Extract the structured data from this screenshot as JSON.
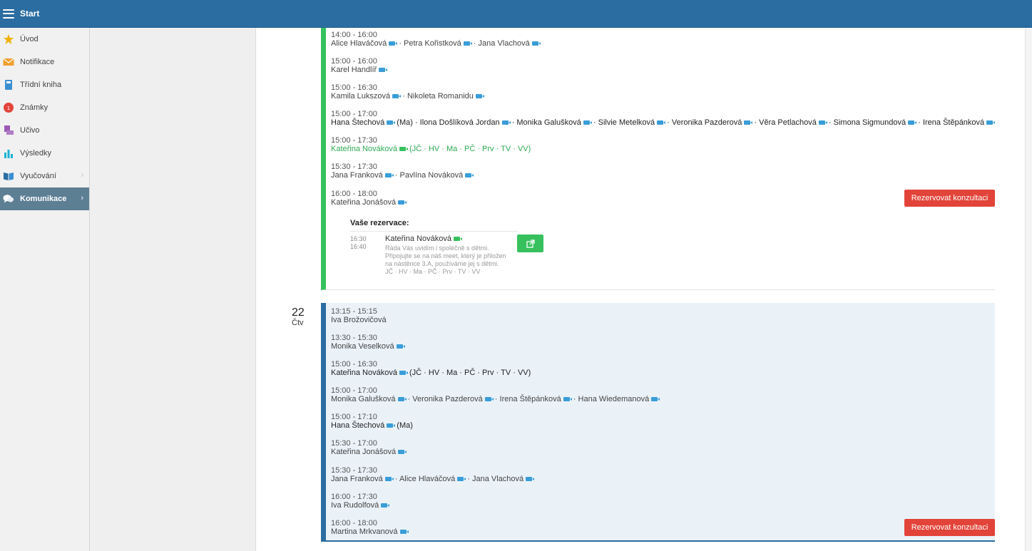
{
  "topbar": {
    "title": "Start"
  },
  "sidebar": {
    "items": [
      {
        "label": "Úvod",
        "icon": "star-icon",
        "color": "#f0b400"
      },
      {
        "label": "Notifikace",
        "icon": "envelope-icon",
        "color": "#f0a030"
      },
      {
        "label": "Třídní kniha",
        "icon": "book-icon",
        "color": "#3a8fd1"
      },
      {
        "label": "Známky",
        "icon": "grades-icon",
        "color": "#e2443a"
      },
      {
        "label": "Učivo",
        "icon": "curriculum-icon",
        "color": "#9b59b6"
      },
      {
        "label": "Výsledky",
        "icon": "bar-chart-icon",
        "color": "#1bb3d3"
      },
      {
        "label": "Vyučování",
        "icon": "open-book-icon",
        "color": "#2b6ca1"
      },
      {
        "label": "Komunikace",
        "icon": "chat-icon",
        "color": "#ffffff"
      }
    ]
  },
  "day1": {
    "slots": [
      {
        "time": "14:00 - 16:00",
        "people": [
          "Alice Hlaváčová",
          "Petra Kořistková",
          "Jana Vlachová"
        ],
        "suffix": ""
      },
      {
        "time": "15:00 - 16:00",
        "people": [
          "Karel Handlíř"
        ],
        "suffix": ""
      },
      {
        "time": "15:00 - 16:30",
        "people": [
          "Kamila Lukszová",
          "Nikoleta Romanidu"
        ],
        "suffix": ""
      },
      {
        "time": "15:00 - 17:00",
        "people": [
          "Hana Štechová",
          "Ilona Došlíková Jordan",
          "Monika Galušková",
          "Silvie Metelková",
          "Veronika Pazderová",
          "Věra Petlachová",
          "Simona Sigmundová",
          "Irena Štěpánková"
        ],
        "suffix": "(Ma)"
      },
      {
        "time": "15:00 - 17:30",
        "people": [
          "Kateřina Nováková"
        ],
        "suffix": "(JČ · HV · Ma · PČ · Prv · TV · VV)"
      },
      {
        "time": "15:30 - 17:30",
        "people": [
          "Jana Franková",
          "Pavlína Nováková"
        ],
        "suffix": ""
      },
      {
        "time": "16:00 - 18:00",
        "people": [
          "Kateřina Jonášová"
        ],
        "suffix": ""
      }
    ],
    "reserve_button": "Rezervovat konzultaci",
    "reservation": {
      "title": "Vaše rezervace:",
      "time_from": "16:30",
      "time_to": "16:40",
      "name": "Kateřina Nováková",
      "note_lines": [
        "Ráda Vás uvidím i společně s dětmi.",
        "Připojujte se na náš meet, který je přiložen",
        "na nástěnce 3.A, používáme jej s dětmi.",
        "JČ · HV · Ma · PČ · Prv · TV · VV"
      ]
    }
  },
  "day2": {
    "num": "22",
    "name": "Čtv",
    "slots": [
      {
        "time": "13:15 - 15:15",
        "people": [
          "Iva Brožovičová"
        ],
        "suffix": "",
        "nocam": true
      },
      {
        "time": "13:30 - 15:30",
        "people": [
          "Monika Veselková"
        ],
        "suffix": ""
      },
      {
        "time": "15:00 - 16:30",
        "people": [
          "Kateřina Nováková"
        ],
        "suffix": "(JČ · HV · Ma · PČ · Prv · TV · VV)"
      },
      {
        "time": "15:00 - 17:00",
        "people": [
          "Monika Galušková",
          "Veronika Pazderová",
          "Irena Štěpánková",
          "Hana Wiedemanová"
        ],
        "suffix": ""
      },
      {
        "time": "15:00 - 17:10",
        "people": [
          "Hana Štechová"
        ],
        "suffix": "(Ma)"
      },
      {
        "time": "15:30 - 17:00",
        "people": [
          "Kateřina Jonášová"
        ],
        "suffix": ""
      },
      {
        "time": "15:30 - 17:30",
        "people": [
          "Jana Franková",
          "Alice Hlaváčová",
          "Jana Vlachová"
        ],
        "suffix": ""
      },
      {
        "time": "16:00 - 17:30",
        "people": [
          "Iva Rudolfová"
        ],
        "suffix": ""
      },
      {
        "time": "16:00 - 18:00",
        "people": [
          "Martina Mrkvanová"
        ],
        "suffix": ""
      }
    ],
    "reserve_button": "Rezervovat konzultaci"
  }
}
